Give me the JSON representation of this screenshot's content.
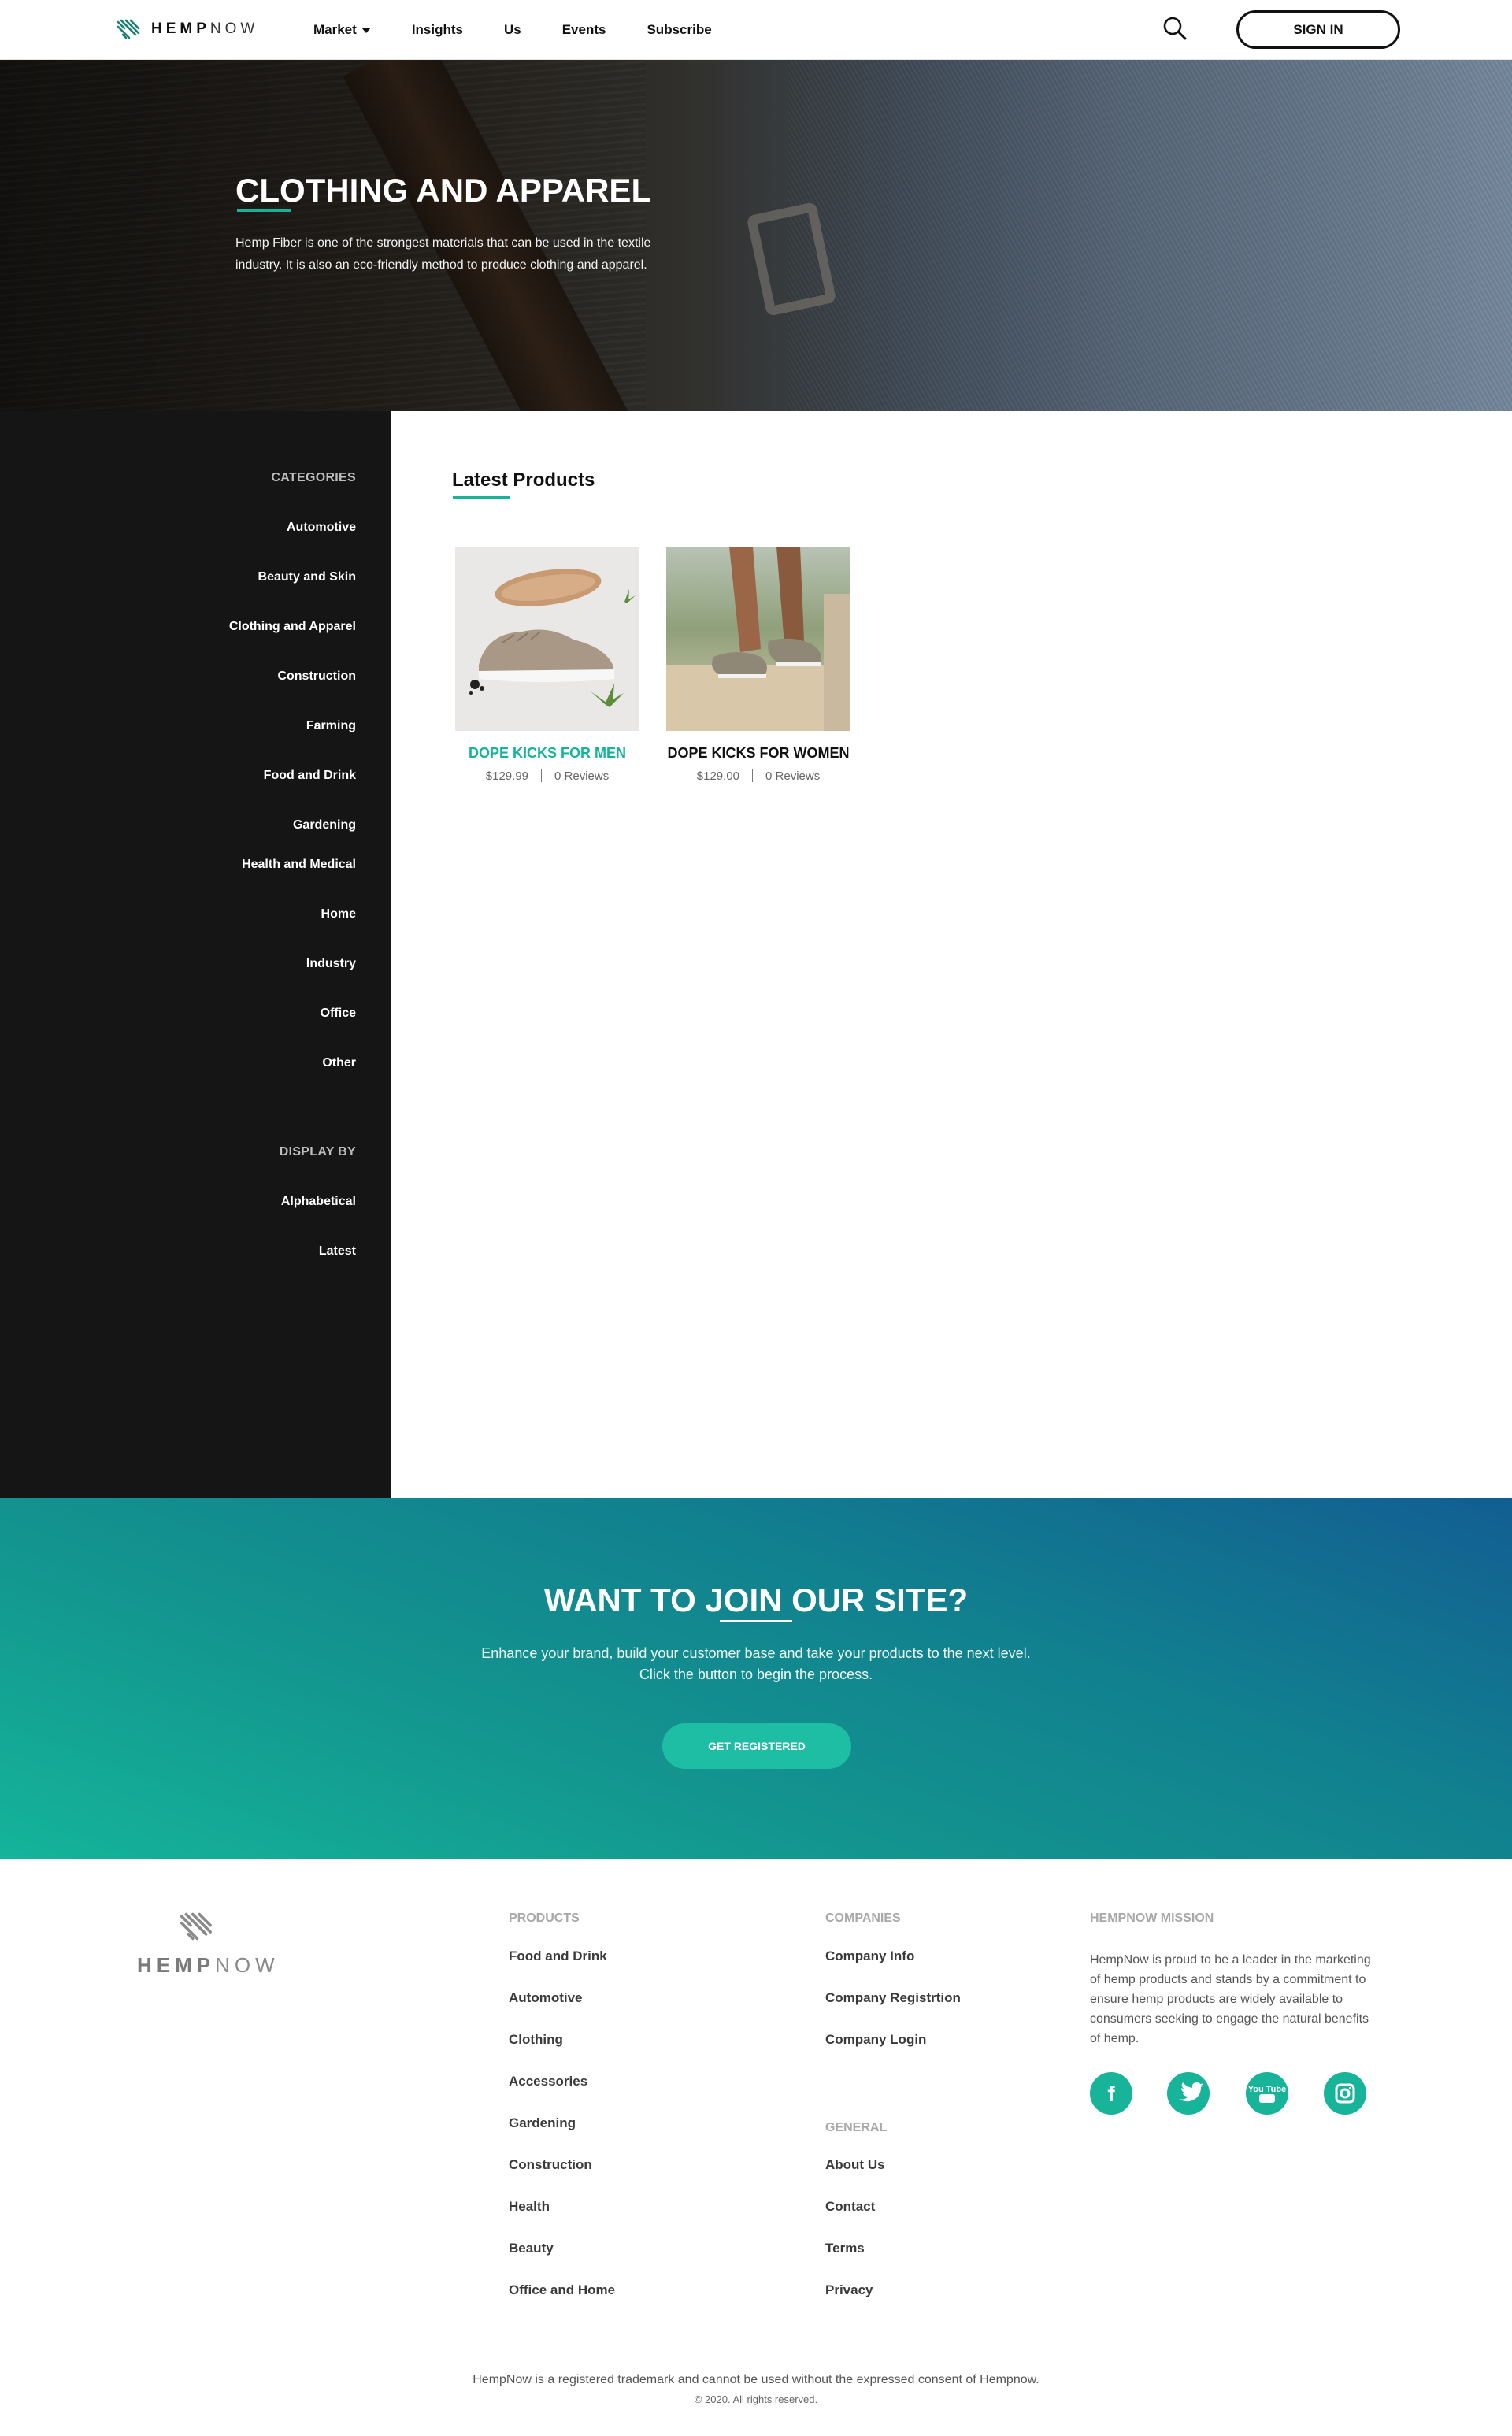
{
  "navbar": {
    "logo": {
      "bold": "HEMP",
      "thin": "NOW"
    },
    "links": [
      "Market",
      "Insights",
      "Us",
      "Events",
      "Subscribe"
    ],
    "signin_label": "SIGN IN"
  },
  "hero": {
    "title": "CLOTHING AND APPAREL",
    "description": "Hemp Fiber is one of the strongest materials that can be used in the textile industry. It is also an eco-friendly method to produce clothing and apparel."
  },
  "sidebar": {
    "categories_label": "CATEGORIES",
    "categories": [
      "Automotive",
      "Beauty and Skin",
      "Clothing and Apparel",
      "Construction",
      "Farming",
      "Food and Drink",
      "Gardening",
      "Health and Medical",
      "Home",
      "Industry",
      "Office",
      "Other"
    ],
    "display_label": "DISPLAY BY",
    "display": [
      "Alphabetical",
      "Latest"
    ]
  },
  "main": {
    "title": "Latest Products",
    "products": [
      {
        "name": "DOPE KICKS FOR MEN",
        "price": "$129.99",
        "reviews": "0 Reviews",
        "name_color": "#16b497"
      },
      {
        "name": "DOPE KICKS FOR WOMEN",
        "price": "$129.00",
        "reviews": "0 Reviews",
        "name_color": "#111111"
      }
    ]
  },
  "join": {
    "title_pre": "WANT TO",
    "title_highlight": "JOIN",
    "title_post": "OUR SITE?",
    "line1": "Enhance your brand, build your customer base and take your products to the next level.",
    "line2": "Click the button to begin the process.",
    "button": "GET REGISTERED"
  },
  "footer": {
    "logo": {
      "bold": "HEMP",
      "thin": "NOW"
    },
    "products_head": "PRODUCTS",
    "products": [
      "Food and Drink",
      "Automotive",
      "Clothing",
      "Accessories",
      "Gardening",
      "Construction",
      "Health",
      "Beauty",
      "Office and Home"
    ],
    "companies_head": "COMPANIES",
    "companies": [
      "Company Info",
      "Company Registrtion",
      "Company Login"
    ],
    "general_head": "GENERAL",
    "general": [
      "About Us",
      "Contact",
      "Terms",
      "Privacy"
    ],
    "mission_head": "HEMPNOW MISSION",
    "mission_text": "HempNow is proud to be a leader in the marketing of hemp products and stands by a commitment to ensure hemp products are widely available to consumers seeking to engage the natural benefits of hemp.",
    "social": [
      "facebook-icon",
      "twitter-icon",
      "youtube-icon",
      "instagram-icon"
    ],
    "youtube_label": "You Tube",
    "legal": "HempNow is a registered trademark and cannot be used without the expressed consent of Hempnow.",
    "copyright": "© 2020. All rights reserved."
  },
  "colors": {
    "accent": "#16b497",
    "sidebar_bg": "#151515",
    "banner_from": "#14b49a",
    "banner_to": "#125e92"
  }
}
